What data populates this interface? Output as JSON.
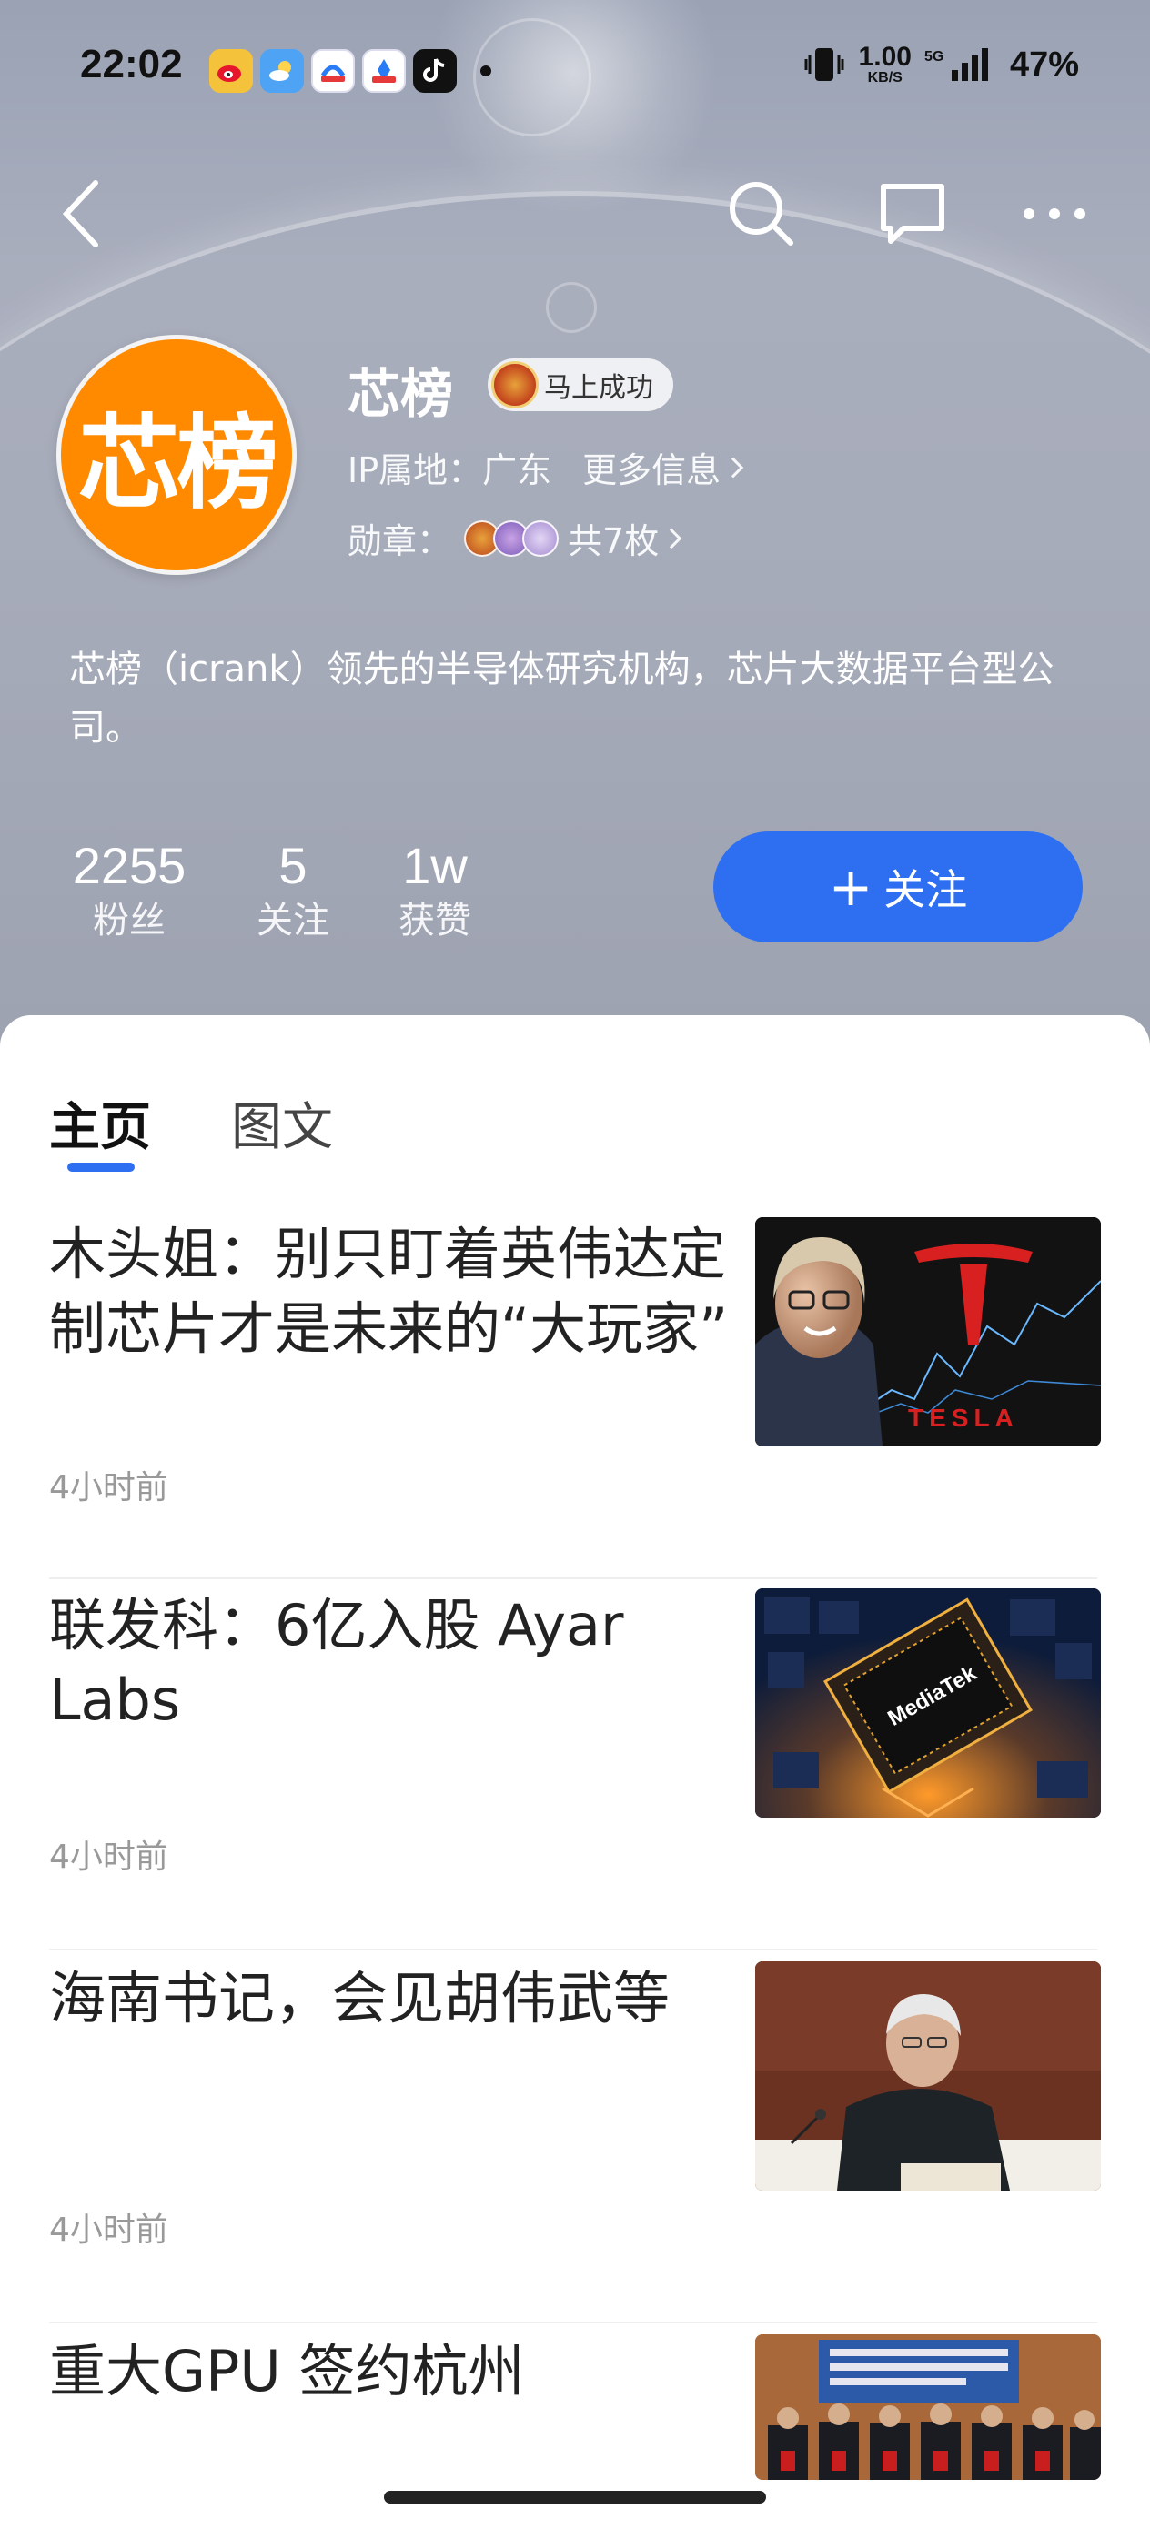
{
  "status_bar": {
    "time": "22:02",
    "apps": [
      "weibo-app-icon",
      "weather-app-icon",
      "shopping-app-icon",
      "health-app-icon",
      "tiktok-app-icon"
    ],
    "net_speed_value": "1.00",
    "net_speed_unit": "KB/S",
    "network": "5G",
    "battery": "47%"
  },
  "nav": {
    "back_icon": "back-icon",
    "search_icon": "search-icon",
    "message_icon": "message-icon",
    "more_icon": "more-icon"
  },
  "profile": {
    "avatar_text": "芯榜",
    "name": "芯榜",
    "title_badge": "马上成功",
    "ip_label": "IP属地：广东",
    "more_info": "更多信息",
    "badges_label": "勋章：",
    "badges_count": "共7枚",
    "bio": "芯榜（icrank）领先的半导体研究机构，芯片大数据平台型公司。"
  },
  "stats": [
    {
      "value": "2255",
      "label": "粉丝"
    },
    {
      "value": "5",
      "label": "关注"
    },
    {
      "value": "1w",
      "label": "获赞"
    }
  ],
  "follow_button": {
    "plus": "+",
    "label": "关注"
  },
  "tabs": [
    {
      "label": "主页",
      "active": true
    },
    {
      "label": "图文",
      "active": false
    }
  ],
  "articles": [
    {
      "title": "木头姐：别只盯着英伟达定制芯片才是未来的“大玩家”",
      "time": "4小时前",
      "thumb_text": "TESLA"
    },
    {
      "title": "联发科：6亿入股 Ayar Labs",
      "time": "4小时前",
      "thumb_text": "MediaTek"
    },
    {
      "title": "海南书记，会见胡伟武等",
      "time": "4小时前",
      "thumb_text": ""
    },
    {
      "title": "重大GPU 签约杭州",
      "time": "",
      "thumb_text": ""
    }
  ],
  "colors": {
    "accent": "#2e6ff2",
    "avatar_bg": "#ff8a00",
    "hero_bg": "#a6abb9"
  }
}
